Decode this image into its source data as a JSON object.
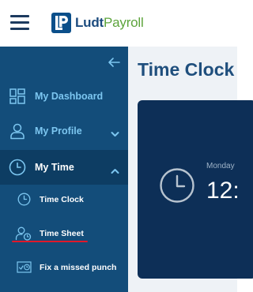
{
  "header": {
    "menu_icon": "hamburger-menu-icon",
    "logo": {
      "part1": "Ludt",
      "part2": "Payroll",
      "brand_color": "#0b4f8a",
      "accent_color": "#5da43c"
    }
  },
  "sidebar": {
    "collapse_icon": "arrow-left-icon",
    "items": [
      {
        "label": "My Dashboard",
        "icon": "dashboard-icon"
      },
      {
        "label": "My Profile",
        "icon": "user-icon",
        "chevron": "chevron-down-icon"
      },
      {
        "label": "My Time",
        "icon": "clock-icon",
        "chevron": "chevron-up-icon",
        "active": true
      }
    ],
    "subitems": [
      {
        "label": "Time Clock",
        "icon": "clock-icon"
      },
      {
        "label": "Time Sheet",
        "icon": "user-clock-icon",
        "highlighted": true
      },
      {
        "label": "Fix a missed punch",
        "icon": "timesheet-clock-icon"
      }
    ]
  },
  "main": {
    "title": "Time Clock",
    "card": {
      "day": "Monday",
      "time": "12:"
    }
  },
  "colors": {
    "sidebar_bg": "#134d7a",
    "sidebar_active_bg": "#0d3d63",
    "nav_text": "#7cc6f0",
    "card_bg": "#0d2f57",
    "underline": "#e0192a"
  }
}
